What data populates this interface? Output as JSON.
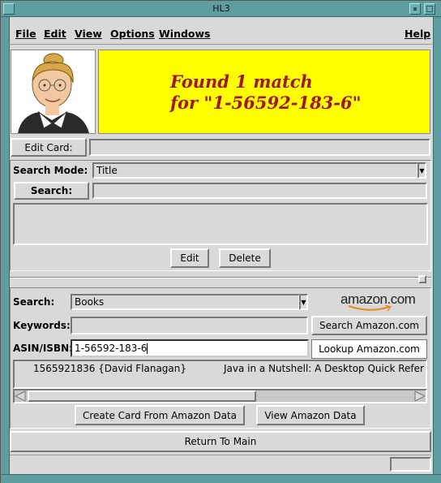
{
  "window": {
    "title": "HL3"
  },
  "menu": {
    "file": "File",
    "edit": "Edit",
    "view": "View",
    "options": "Options",
    "windows": "Windows",
    "help": "Help"
  },
  "banner": {
    "line1": "Found 1 match",
    "line2": "for \"1-56592-183-6\""
  },
  "edit_card": {
    "button": "Edit Card:",
    "value": ""
  },
  "search_mode": {
    "label": "Search Mode:",
    "selected": "Title"
  },
  "search": {
    "button": "Search:",
    "value": ""
  },
  "results_actions": {
    "edit": "Edit",
    "delete": "Delete"
  },
  "amazon": {
    "search_label": "Search:",
    "search_selected": "Books",
    "logo_text": "amazon.com",
    "keywords_label": "Keywords:",
    "keywords_value": "",
    "search_button": "Search Amazon.com",
    "asin_label": "ASIN/ISBN:",
    "asin_value": "1-56592-183-6",
    "lookup_button": "Lookup Amazon.com",
    "result": {
      "id": "1565921836 {David Flanagan}",
      "title": "Java in a Nutshell: A Desktop Quick Refer"
    },
    "create_button": "Create Card From Amazon Data",
    "view_button": "View Amazon Data"
  },
  "return_button": "Return To Main",
  "colors": {
    "banner_bg": "#ffff00",
    "banner_text": "#a01818",
    "frame": "#5f9ea0",
    "panel": "#d9d9d9"
  }
}
